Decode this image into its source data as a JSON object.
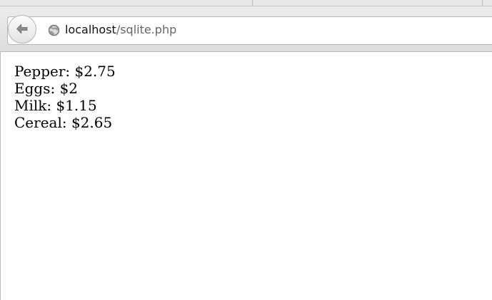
{
  "browser": {
    "address": {
      "host": "localhost",
      "path": "/sqlite.php"
    }
  },
  "page": {
    "items": [
      {
        "text": "Pepper: $2.75"
      },
      {
        "text": "Eggs: $2"
      },
      {
        "text": "Milk: $1.15"
      },
      {
        "text": "Cereal: $2.65"
      }
    ]
  },
  "icons": {
    "back": "arrow-left-icon",
    "site": "globe-icon"
  },
  "colors": {
    "chrome": "#dddddd",
    "url_host": "#111111",
    "url_path": "#666666",
    "page_text": "#000000"
  }
}
